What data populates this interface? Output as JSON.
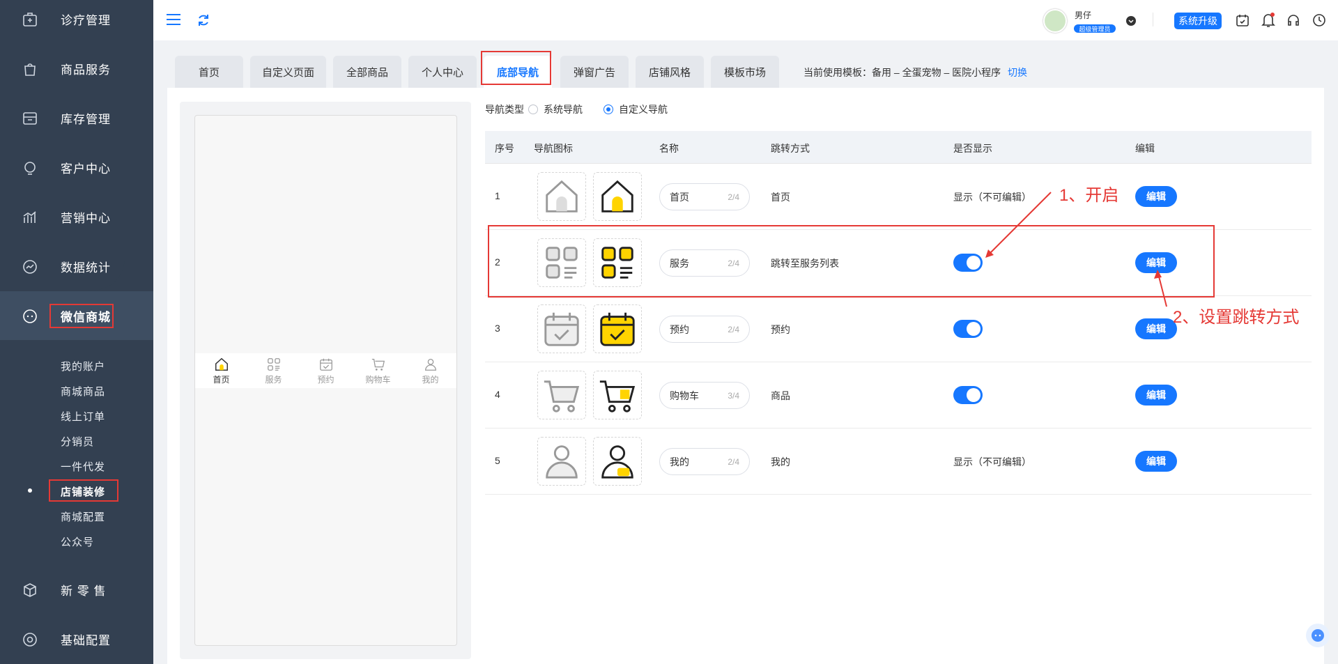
{
  "sidebar": {
    "menu": [
      {
        "label": "诊疗管理",
        "icon": "medical-kit-icon"
      },
      {
        "label": "商品服务",
        "icon": "bag-icon"
      },
      {
        "label": "库存管理",
        "icon": "box-icon"
      },
      {
        "label": "客户中心",
        "icon": "user-head-icon"
      },
      {
        "label": "营销中心",
        "icon": "chart-bar-icon"
      },
      {
        "label": "数据统计",
        "icon": "trend-icon"
      },
      {
        "label": "微信商城",
        "icon": "chat-icon"
      },
      {
        "label": "新 零 售",
        "icon": "package-icon"
      },
      {
        "label": "基础配置",
        "icon": "settings-icon"
      }
    ],
    "sub": [
      "我的账户",
      "商城商品",
      "线上订单",
      "分销员",
      "一件代发",
      "店铺装修",
      "商城配置",
      "公众号"
    ]
  },
  "topbar": {
    "user_name": "男仔",
    "user_role": "超级管理员",
    "upgrade_label": "系统升级"
  },
  "tabs": [
    "首页",
    "自定义页面",
    "全部商品",
    "个人中心",
    "底部导航",
    "弹窗广告",
    "店铺风格",
    "模板市场"
  ],
  "template": {
    "prefix": "当前使用模板：备用 – 全蛋宠物 – 医院小程序",
    "switch": "切换"
  },
  "nav_type": {
    "label": "导航类型",
    "options": [
      "系统导航",
      "自定义导航"
    ],
    "selected": "自定义导航"
  },
  "phone_nav": [
    "首页",
    "服务",
    "预约",
    "购物车",
    "我的"
  ],
  "table": {
    "headers": [
      "序号",
      "导航图标",
      "名称",
      "跳转方式",
      "是否显示",
      "编辑"
    ],
    "rows": [
      {
        "no": "1",
        "name": "首页",
        "count": "2/4",
        "jump": "首页",
        "show": "显示（不可编辑）",
        "icon": "home-icon",
        "edit": "编辑"
      },
      {
        "no": "2",
        "name": "服务",
        "count": "2/4",
        "jump": "跳转至服务列表",
        "show": "toggle-on",
        "icon": "grid-icon",
        "edit": "编辑"
      },
      {
        "no": "3",
        "name": "预约",
        "count": "2/4",
        "jump": "预约",
        "show": "toggle-on",
        "icon": "calendar-icon",
        "edit": "编辑"
      },
      {
        "no": "4",
        "name": "购物车",
        "count": "3/4",
        "jump": "商品",
        "show": "toggle-on",
        "icon": "cart-icon",
        "edit": "编辑"
      },
      {
        "no": "5",
        "name": "我的",
        "count": "2/4",
        "jump": "我的",
        "show": "显示（不可编辑）",
        "icon": "person-icon",
        "edit": "编辑"
      }
    ]
  },
  "annotations": {
    "a1": "1、开启",
    "a2": "2、设置跳转方式"
  },
  "colors": {
    "sidebar": "#334051",
    "accent": "#1677ff",
    "highlight": "#e53935",
    "icon_yellow": "#ffd400"
  }
}
